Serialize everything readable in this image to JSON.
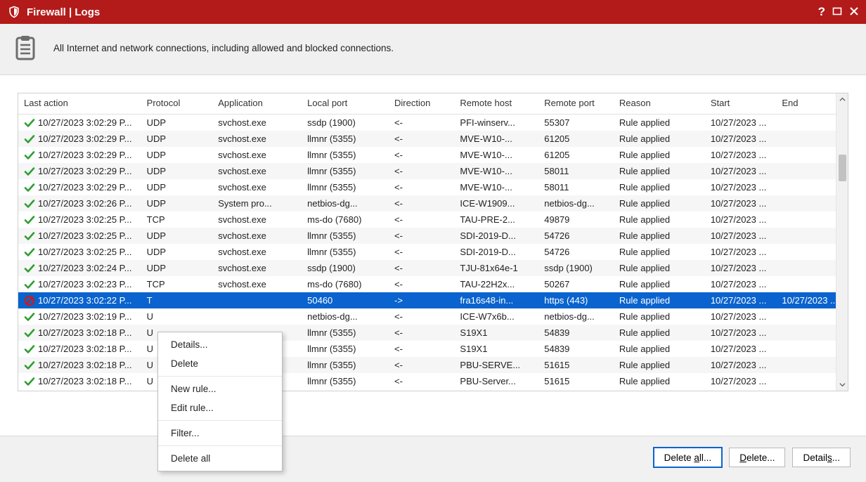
{
  "titlebar": {
    "title": "Firewall | Logs"
  },
  "subheader": {
    "desc": "All Internet and network connections, including allowed and blocked connections."
  },
  "columns": {
    "c0": "Last action",
    "c1": "Protocol",
    "c2": "Application",
    "c3": "Local port",
    "c4": "Direction",
    "c5": "Remote host",
    "c6": "Remote port",
    "c7": "Reason",
    "c8": "Start",
    "c9": "End"
  },
  "rows": [
    {
      "icon": "allow",
      "lastaction": "10/27/2023 3:02:29 P...",
      "protocol": "UDP",
      "application": "svchost.exe",
      "localport": "ssdp (1900)",
      "direction": "<-",
      "remotehost": "PFI-winserv...",
      "remoteport": "55307",
      "reason": "Rule applied",
      "start": "10/27/2023 ...",
      "end": ""
    },
    {
      "icon": "allow",
      "lastaction": "10/27/2023 3:02:29 P...",
      "protocol": "UDP",
      "application": "svchost.exe",
      "localport": "llmnr (5355)",
      "direction": "<-",
      "remotehost": "MVE-W10-...",
      "remoteport": "61205",
      "reason": "Rule applied",
      "start": "10/27/2023 ...",
      "end": ""
    },
    {
      "icon": "allow",
      "lastaction": "10/27/2023 3:02:29 P...",
      "protocol": "UDP",
      "application": "svchost.exe",
      "localport": "llmnr (5355)",
      "direction": "<-",
      "remotehost": "MVE-W10-...",
      "remoteport": "61205",
      "reason": "Rule applied",
      "start": "10/27/2023 ...",
      "end": ""
    },
    {
      "icon": "allow",
      "lastaction": "10/27/2023 3:02:29 P...",
      "protocol": "UDP",
      "application": "svchost.exe",
      "localport": "llmnr (5355)",
      "direction": "<-",
      "remotehost": "MVE-W10-...",
      "remoteport": "58011",
      "reason": "Rule applied",
      "start": "10/27/2023 ...",
      "end": ""
    },
    {
      "icon": "allow",
      "lastaction": "10/27/2023 3:02:29 P...",
      "protocol": "UDP",
      "application": "svchost.exe",
      "localport": "llmnr (5355)",
      "direction": "<-",
      "remotehost": "MVE-W10-...",
      "remoteport": "58011",
      "reason": "Rule applied",
      "start": "10/27/2023 ...",
      "end": ""
    },
    {
      "icon": "allow",
      "lastaction": "10/27/2023 3:02:26 P...",
      "protocol": "UDP",
      "application": "System pro...",
      "localport": "netbios-dg...",
      "direction": "<-",
      "remotehost": "ICE-W1909...",
      "remoteport": "netbios-dg...",
      "reason": "Rule applied",
      "start": "10/27/2023 ...",
      "end": ""
    },
    {
      "icon": "allow",
      "lastaction": "10/27/2023 3:02:25 P...",
      "protocol": "TCP",
      "application": "svchost.exe",
      "localport": "ms-do (7680)",
      "direction": "<-",
      "remotehost": "TAU-PRE-2...",
      "remoteport": "49879",
      "reason": "Rule applied",
      "start": "10/27/2023 ...",
      "end": ""
    },
    {
      "icon": "allow",
      "lastaction": "10/27/2023 3:02:25 P...",
      "protocol": "UDP",
      "application": "svchost.exe",
      "localport": "llmnr (5355)",
      "direction": "<-",
      "remotehost": "SDI-2019-D...",
      "remoteport": "54726",
      "reason": "Rule applied",
      "start": "10/27/2023 ...",
      "end": ""
    },
    {
      "icon": "allow",
      "lastaction": "10/27/2023 3:02:25 P...",
      "protocol": "UDP",
      "application": "svchost.exe",
      "localport": "llmnr (5355)",
      "direction": "<-",
      "remotehost": "SDI-2019-D...",
      "remoteport": "54726",
      "reason": "Rule applied",
      "start": "10/27/2023 ...",
      "end": ""
    },
    {
      "icon": "allow",
      "lastaction": "10/27/2023 3:02:24 P...",
      "protocol": "UDP",
      "application": "svchost.exe",
      "localport": "ssdp (1900)",
      "direction": "<-",
      "remotehost": "TJU-81x64e-1",
      "remoteport": "ssdp (1900)",
      "reason": "Rule applied",
      "start": "10/27/2023 ...",
      "end": ""
    },
    {
      "icon": "allow",
      "lastaction": "10/27/2023 3:02:23 P...",
      "protocol": "TCP",
      "application": "svchost.exe",
      "localport": "ms-do (7680)",
      "direction": "<-",
      "remotehost": "TAU-22H2x...",
      "remoteport": "50267",
      "reason": "Rule applied",
      "start": "10/27/2023 ...",
      "end": ""
    },
    {
      "icon": "block",
      "lastaction": "10/27/2023 3:02:22 P...",
      "protocol": "T",
      "application": "",
      "localport": "50460",
      "direction": "->",
      "remotehost": "fra16s48-in...",
      "remoteport": "https (443)",
      "reason": "Rule applied",
      "start": "10/27/2023 ...",
      "end": "10/27/2023 ..."
    },
    {
      "icon": "allow",
      "lastaction": "10/27/2023 3:02:19 P...",
      "protocol": "U",
      "application": "",
      "localport": "netbios-dg...",
      "direction": "<-",
      "remotehost": "ICE-W7x6b...",
      "remoteport": "netbios-dg...",
      "reason": "Rule applied",
      "start": "10/27/2023 ...",
      "end": ""
    },
    {
      "icon": "allow",
      "lastaction": "10/27/2023 3:02:18 P...",
      "protocol": "U",
      "application": "",
      "localport": "llmnr (5355)",
      "direction": "<-",
      "remotehost": "S19X1",
      "remoteport": "54839",
      "reason": "Rule applied",
      "start": "10/27/2023 ...",
      "end": ""
    },
    {
      "icon": "allow",
      "lastaction": "10/27/2023 3:02:18 P...",
      "protocol": "U",
      "application": "",
      "localport": "llmnr (5355)",
      "direction": "<-",
      "remotehost": "S19X1",
      "remoteport": "54839",
      "reason": "Rule applied",
      "start": "10/27/2023 ...",
      "end": ""
    },
    {
      "icon": "allow",
      "lastaction": "10/27/2023 3:02:18 P...",
      "protocol": "U",
      "application": "",
      "localport": "llmnr (5355)",
      "direction": "<-",
      "remotehost": "PBU-SERVE...",
      "remoteport": "51615",
      "reason": "Rule applied",
      "start": "10/27/2023 ...",
      "end": ""
    },
    {
      "icon": "allow",
      "lastaction": "10/27/2023 3:02:18 P...",
      "protocol": "U",
      "application": "",
      "localport": "llmnr (5355)",
      "direction": "<-",
      "remotehost": "PBU-Server...",
      "remoteport": "51615",
      "reason": "Rule applied",
      "start": "10/27/2023 ...",
      "end": ""
    }
  ],
  "selected_index": 11,
  "context_menu": {
    "details": "Details...",
    "delete": "Delete",
    "new_rule": "New rule...",
    "edit_rule": "Edit rule...",
    "filter": "Filter...",
    "delete_all": "Delete all"
  },
  "footer": {
    "delete_all": "Delete all...",
    "delete": "Delete...",
    "details": "Details..."
  }
}
